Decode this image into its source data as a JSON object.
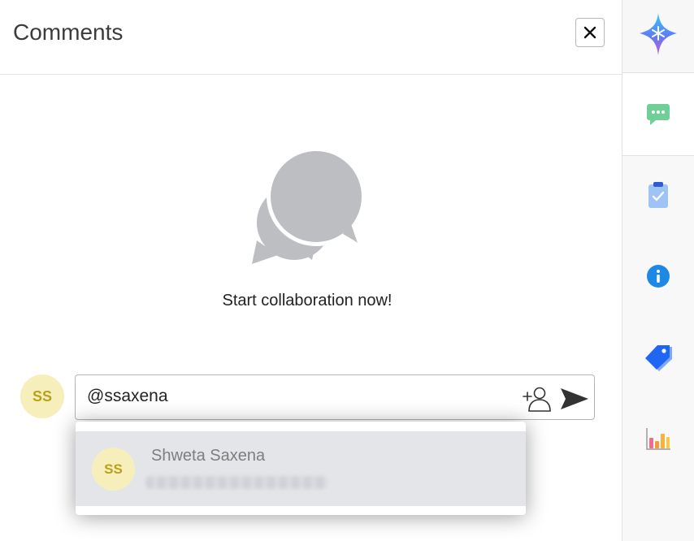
{
  "header": {
    "title": "Comments"
  },
  "empty_state": {
    "message": "Start collaboration now!"
  },
  "composer": {
    "user_initials": "SS",
    "input_value": "@ssaxena"
  },
  "mention_dropdown": {
    "items": [
      {
        "initials": "SS",
        "name": "Shweta Saxena"
      }
    ]
  },
  "rail": {
    "items": [
      "ai-sparkle-icon",
      "comments-icon",
      "clipboard-check-icon",
      "info-icon",
      "tag-icon",
      "bar-chart-icon"
    ]
  },
  "colors": {
    "avatar_bg": "#f6efbc",
    "avatar_text": "#b9a11a",
    "comments_green": "#6fcf97",
    "info_blue": "#1e88e5",
    "tag_blue": "#1f66f2"
  }
}
